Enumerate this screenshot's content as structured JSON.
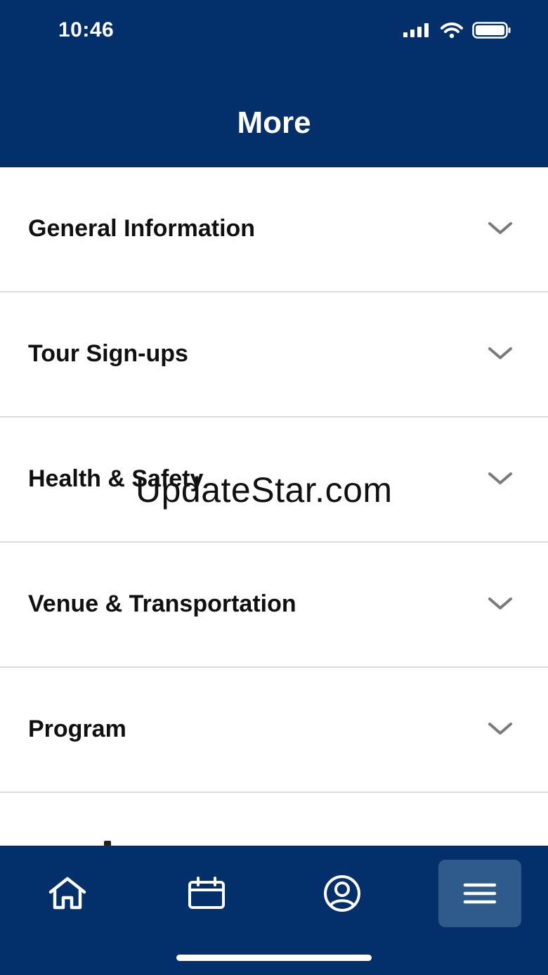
{
  "status_bar": {
    "time": "10:46",
    "signal_icon": "cellular-signal-icon",
    "wifi_icon": "wifi-icon",
    "battery_icon": "battery-icon"
  },
  "header": {
    "title": "More"
  },
  "menu": {
    "items": [
      {
        "label": "General Information",
        "icon": "chevron-down-icon"
      },
      {
        "label": "Tour Sign-ups",
        "icon": "chevron-down-icon"
      },
      {
        "label": "Health & Safety",
        "icon": "chevron-down-icon"
      },
      {
        "label": "Venue & Transportation",
        "icon": "chevron-down-icon"
      },
      {
        "label": "Program",
        "icon": "chevron-down-icon"
      }
    ]
  },
  "watermark": {
    "text": "UpdateStar.com"
  },
  "tab_bar": {
    "tabs": [
      {
        "name": "home",
        "icon": "home-icon"
      },
      {
        "name": "calendar",
        "icon": "calendar-icon"
      },
      {
        "name": "profile",
        "icon": "user-circle-icon"
      },
      {
        "name": "menu",
        "icon": "hamburger-menu-icon",
        "active": true
      }
    ]
  },
  "colors": {
    "primary": "#03306b",
    "active_tab": "#2f5b8c",
    "divider": "#dcdcdc",
    "text": "#101010",
    "chevron": "#7a7a7a"
  }
}
